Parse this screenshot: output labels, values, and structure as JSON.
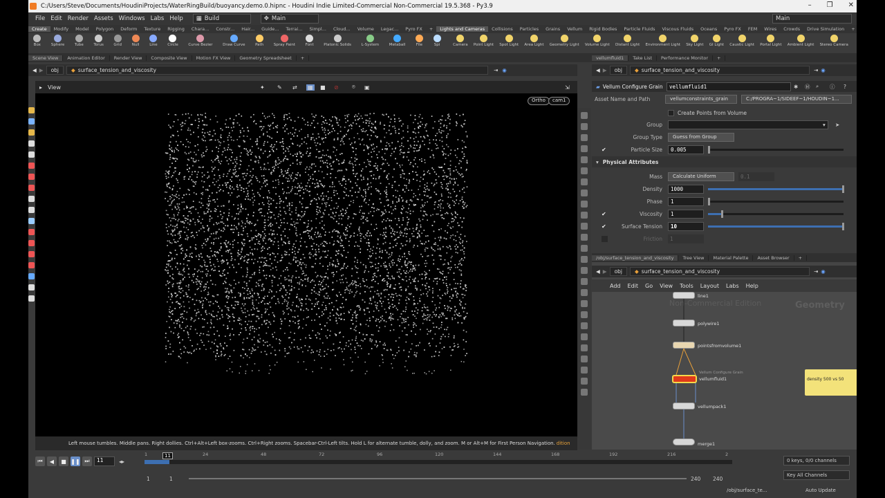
{
  "window": {
    "title": "C:/Users/Steve/Documents/HoudiniProjects/WaterRingBuild/buoyancy.demo.0.hipnc - Houdini Indie Limited-Commercial Non-Commercial 19.5.368 - Py3.9",
    "minimize": "–",
    "maximize": "❐",
    "close": "✕"
  },
  "menu": [
    "File",
    "Edit",
    "Render",
    "Assets",
    "Windows",
    "Labs",
    "Help"
  ],
  "desktop_left": "Build",
  "desktop_right": "Main",
  "shelf_tabs_left": [
    "Create",
    "Modify",
    "Model",
    "Polygon",
    "Deform",
    "Texture",
    "Rigging",
    "Chara...",
    "Constr...",
    "Hair...",
    "Guide...",
    "Terrai...",
    "Simpl...",
    "Cloud...",
    "Volume",
    "Legac...",
    "Pyro FX",
    "+"
  ],
  "shelf_tabs_right": [
    "Lights and Cameras",
    "Collisions",
    "Particles",
    "Grains",
    "Vellum",
    "Rigid Bodies",
    "Particle Fluids",
    "Viscous Fluids",
    "Oceans",
    "Pyro FX",
    "FEM",
    "Wires",
    "Crowds",
    "Drive Simulation",
    "+"
  ],
  "shelf_tools_left": [
    "Box",
    "Sphere",
    "Tube",
    "Torus",
    "Grid",
    "Null",
    "Line",
    "Circle",
    "Curve Bezier",
    "Draw Curve",
    "Path",
    "Spray Paint",
    "Font",
    "Platonic Solids",
    "L-System",
    "Metaball",
    "File",
    "Spi"
  ],
  "shelf_tools_right": [
    "Camera",
    "Point Light",
    "Spot Light",
    "Area Light",
    "Geometry Light",
    "Volume Light",
    "Distant Light",
    "Environment Light",
    "Sky Light",
    "GI Light",
    "Caustic Light",
    "Portal Light",
    "Ambient Light",
    "Stereo Camera"
  ],
  "pane_tabs_left": [
    "Scene View",
    "Animation Editor",
    "Render View",
    "Composite View",
    "Motion FX View",
    "Geometry Spreadsheet",
    "+"
  ],
  "pane_tabs_right": [
    "vellumfluid1",
    "Take List",
    "Performance Monitor",
    "+"
  ],
  "path": {
    "root": "obj",
    "node": "surface_tension_and_viscosity"
  },
  "viewport": {
    "label": "View",
    "projection": "Ortho",
    "camera": "cam1"
  },
  "status_text": "Left mouse tumbles. Middle pans. Right dollies. Ctrl+Alt+Left box-zooms. Ctrl+Right zooms. Spacebar-Ctrl-Left tilts. Hold L for alternate tumble, dolly, and zoom. M or Alt+M for First Person Navigation.",
  "status_suffix": "dition",
  "params": {
    "node_type": "Vellum Configure Grain",
    "node_name": "vellumfluid1",
    "asset_label": "Asset Name and Path",
    "asset_name": "vellumconstraints_grain",
    "asset_path": "C:/PROGRA~1/SIDEEF~1/HOUDIN~1...",
    "create_points": "Create Points from Volume",
    "group_label": "Group",
    "group_value": "",
    "group_type_label": "Group Type",
    "group_type": "Guess from Group",
    "particle_size_label": "Particle Size",
    "particle_size": "0.005",
    "section": "Physical Attributes",
    "mass_label": "Mass",
    "mass_mode": "Calculate Uniform",
    "mass_value": "0.1",
    "density_label": "Density",
    "density": "1000",
    "phase_label": "Phase",
    "phase": "1",
    "viscosity_label": "Viscosity",
    "viscosity": "1",
    "surface_tension_label": "Surface Tension",
    "surface_tension": "10",
    "friction_label": "Friction",
    "friction": "1"
  },
  "net_tabs": [
    "/obj/surface_tension_and_viscosity",
    "Tree View",
    "Material Palette",
    "Asset Browser",
    "+"
  ],
  "net_menu": [
    "Add",
    "Edit",
    "Go",
    "View",
    "Tools",
    "Layout",
    "Labs",
    "Help"
  ],
  "net_watermark": "Non-Commercial Edition",
  "net_context": "Geometry",
  "nodes": [
    {
      "name": "line1",
      "sub": ""
    },
    {
      "name": "polywire1",
      "sub": ""
    },
    {
      "name": "pointsfromvolume1",
      "sub": ""
    },
    {
      "name": "vellumfluid1",
      "sub": "Vellum Configure Grain"
    },
    {
      "name": "vellumpack1",
      "sub": ""
    },
    {
      "name": "merge1",
      "sub": ""
    }
  ],
  "sticky_note": "density 500 vs 50",
  "timeline": {
    "frame": "11",
    "marker": "11",
    "ticks": [
      "1",
      "24",
      "48",
      "72",
      "96",
      "120",
      "144",
      "168",
      "192",
      "216",
      "2"
    ],
    "start": "1",
    "start2": "1",
    "end": "240",
    "end2": "240",
    "keys": "0 keys, 0/0 channels",
    "key_all": "Key All Channels",
    "net_path": "/obj/surface_te...",
    "update": "Auto Update"
  },
  "colors": {
    "selected_node": "#e03a1a",
    "sticky": "#f3e27a",
    "accent": "#3f83d8"
  }
}
